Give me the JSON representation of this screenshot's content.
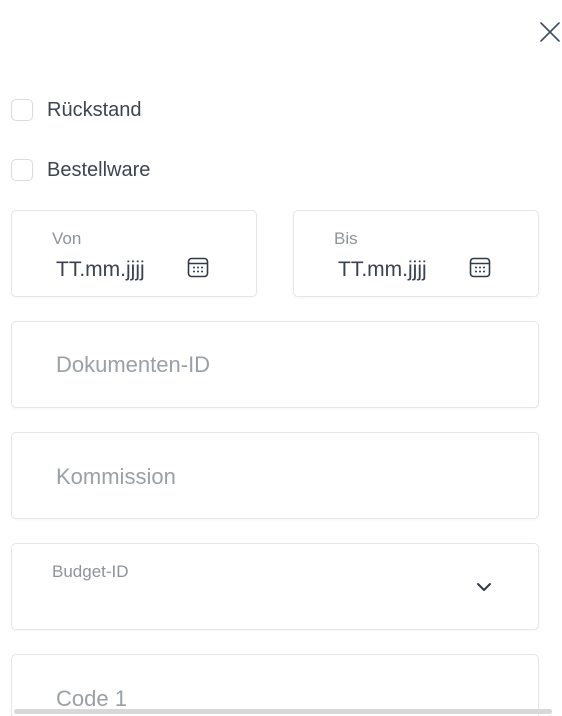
{
  "close": {
    "icon": "close-icon"
  },
  "checkboxes": [
    {
      "label": "Rückstand",
      "checked": false
    },
    {
      "label": "Bestellware",
      "checked": false
    }
  ],
  "date_from": {
    "label": "Von",
    "value": "TT.mm.jjjj",
    "icon": "calendar-icon"
  },
  "date_to": {
    "label": "Bis",
    "value": "TT.mm.jjjj",
    "icon": "calendar-icon"
  },
  "document_id": {
    "placeholder": "Dokumenten-ID"
  },
  "commission": {
    "placeholder": "Kommission"
  },
  "budget": {
    "label": "Budget-ID",
    "value": "",
    "icon": "chevron-down-icon"
  },
  "code1": {
    "placeholder": "Code 1"
  },
  "colors": {
    "text": "#3b4250",
    "placeholder": "#9aa0a8",
    "border": "#e3e6ea",
    "icon": "#2f3a4a"
  }
}
